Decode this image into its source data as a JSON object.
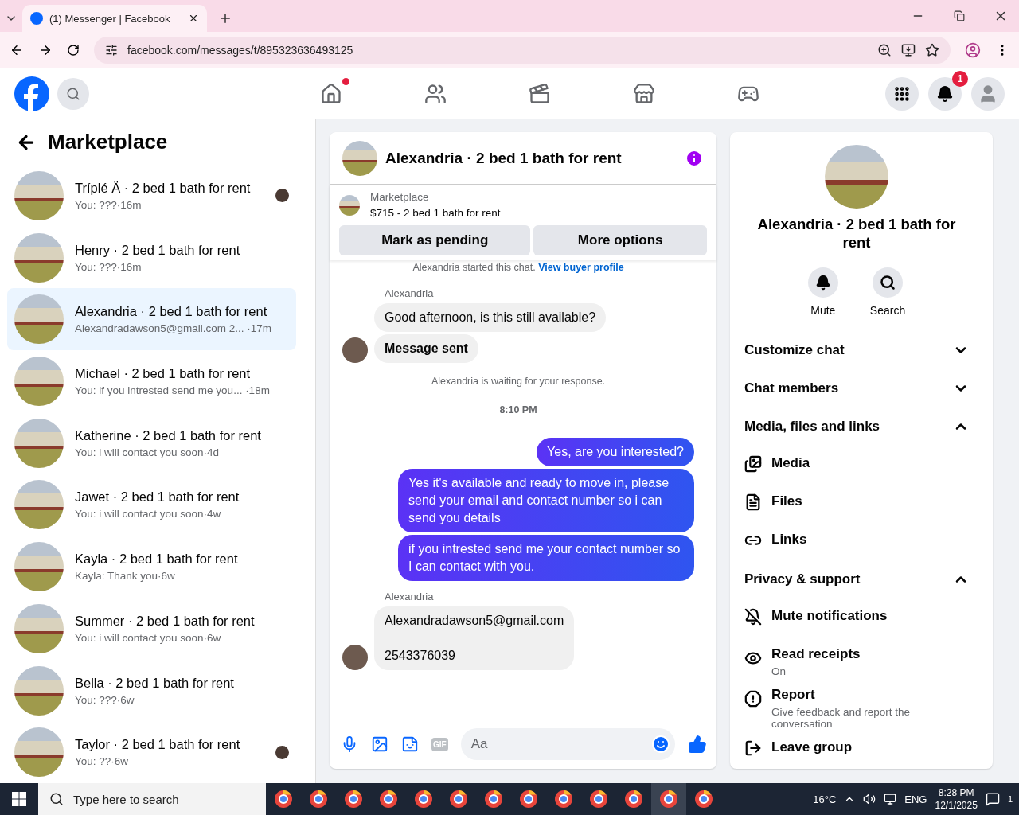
{
  "browser": {
    "tabs": [
      {
        "title": "(1) Messenger | Facebook",
        "selected": true
      }
    ],
    "url": "facebook.com/messages/t/895323636493125"
  },
  "topnav": {
    "items": [
      {
        "kind": "home",
        "dot": true
      },
      {
        "kind": "friends",
        "dot": false
      },
      {
        "kind": "video",
        "dot": false
      },
      {
        "kind": "marketplace",
        "dot": false
      },
      {
        "kind": "gaming",
        "dot": false
      }
    ],
    "notification_count": "1"
  },
  "sidebar": {
    "title": "Marketplace",
    "conversations": [
      {
        "name": "Tríplé Ä · 2 bed 1 bath for rent",
        "preview": "You: ???·16m",
        "selected": false,
        "seen_avatar": true
      },
      {
        "name": "Henry · 2 bed 1 bath for rent",
        "preview": "You: ???·16m",
        "selected": false,
        "seen_avatar": false
      },
      {
        "name": "Alexandria · 2 bed 1 bath for rent",
        "preview": "Alexandradawson5@gmail.com 2... ·17m",
        "selected": true,
        "seen_avatar": false
      },
      {
        "name": "Michael · 2 bed 1 bath for rent",
        "preview": "You: if you intrested send me you... ·18m",
        "selected": false,
        "seen_avatar": false
      },
      {
        "name": "Katherine · 2 bed 1 bath for rent",
        "preview": "You: i will contact you soon·4d",
        "selected": false,
        "seen_avatar": false
      },
      {
        "name": "Jawet · 2 bed 1 bath for rent",
        "preview": "You: i will contact you soon·4w",
        "selected": false,
        "seen_avatar": false
      },
      {
        "name": "Kayla · 2 bed 1 bath for rent",
        "preview": "Kayla: Thank you·6w",
        "selected": false,
        "seen_avatar": false
      },
      {
        "name": "Summer · 2 bed 1 bath for rent",
        "preview": "You: i will contact you soon·6w",
        "selected": false,
        "seen_avatar": false
      },
      {
        "name": "Bella · 2 bed 1 bath for rent",
        "preview": "You: ???·6w",
        "selected": false,
        "seen_avatar": false
      },
      {
        "name": "Taylor · 2 bed 1 bath for rent",
        "preview": "You: ??·6w",
        "selected": false,
        "seen_avatar": true
      }
    ]
  },
  "chat": {
    "title": "Alexandria · 2 bed 1 bath for rent",
    "listing": {
      "label": "Marketplace",
      "text": "$715 - 2 bed 1 bath for rent"
    },
    "buttons": [
      "Mark as pending",
      "More options"
    ],
    "notice": {
      "text": "Alexandria started this chat.",
      "link": "View buyer profile"
    },
    "messages": [
      {
        "kind": "incoming",
        "sender": "Alexandria",
        "bubbles": [
          {
            "lines": [
              "Good afternoon, is this still available?"
            ],
            "bold": false
          },
          {
            "lines": [
              "Message sent"
            ],
            "bold": true
          }
        ]
      },
      {
        "kind": "system",
        "text": "Alexandria is waiting for your response."
      },
      {
        "kind": "timestamp",
        "text": "8:10 PM"
      },
      {
        "kind": "outgoing",
        "bubbles": [
          {
            "lines": [
              "Yes, are you interested?"
            ],
            "bold": false
          },
          {
            "lines": [
              "Yes it's available and ready to move in, please send your email and contact number so i can send you details"
            ],
            "bold": false
          },
          {
            "lines": [
              "if you intrested send me your contact number so I can contact with you."
            ],
            "bold": false
          }
        ]
      },
      {
        "kind": "incoming",
        "sender": "Alexandria",
        "bubbles": [
          {
            "lines": [
              "Alexandradawson5@gmail.com",
              "2543376039"
            ],
            "bold": false
          }
        ]
      }
    ],
    "composer": {
      "placeholder": "Aa",
      "gif_label": "GIF"
    }
  },
  "info": {
    "title": "Alexandria · 2 bed 1 bath for rent",
    "actions": [
      {
        "kind": "mute",
        "label": "Mute"
      },
      {
        "kind": "search",
        "label": "Search"
      }
    ],
    "sections": [
      {
        "title": "Customize chat",
        "expanded": false
      },
      {
        "title": "Chat members",
        "expanded": false
      },
      {
        "title": "Media, files and links",
        "expanded": true,
        "items": [
          {
            "kind": "media",
            "label": "Media"
          },
          {
            "kind": "files",
            "label": "Files"
          },
          {
            "kind": "links",
            "label": "Links"
          }
        ]
      },
      {
        "title": "Privacy & support",
        "expanded": true,
        "items": [
          {
            "kind": "mute",
            "label": "Mute notifications"
          },
          {
            "kind": "receipts",
            "label": "Read receipts",
            "sub": "On"
          },
          {
            "kind": "report",
            "label": "Report",
            "sub": "Give feedback and report the conversation"
          },
          {
            "kind": "leave",
            "label": "Leave group"
          }
        ]
      }
    ]
  },
  "taskbar": {
    "search_placeholder": "Type here to search",
    "apps": [
      {
        "selected": false
      },
      {
        "selected": false
      },
      {
        "selected": false
      },
      {
        "selected": false
      },
      {
        "selected": false
      },
      {
        "selected": false
      },
      {
        "selected": false
      },
      {
        "selected": false
      },
      {
        "selected": false
      },
      {
        "selected": false
      },
      {
        "selected": false
      },
      {
        "selected": true
      },
      {
        "selected": false
      }
    ],
    "temperature": "16°C",
    "language": "ENG",
    "time": "8:28 PM",
    "date": "12/1/2025",
    "notification_count": "1"
  }
}
